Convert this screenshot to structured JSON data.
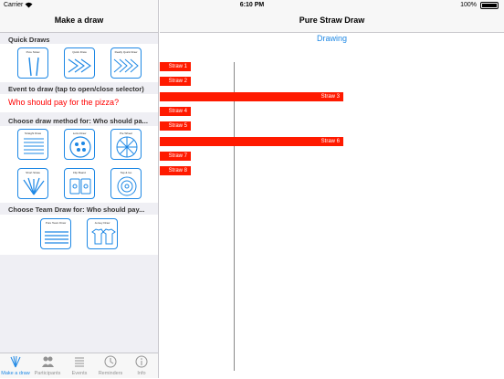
{
  "status_bar": {
    "carrier": "Carrier",
    "wifi_icon": "wifi-icon",
    "time": "6:10 PM",
    "battery": "100%"
  },
  "left": {
    "title": "Make a draw",
    "quick_draws_header": "Quick Draws",
    "quick_draws": [
      {
        "caption": "Pure Straw",
        "icon": "straws-icon"
      },
      {
        "caption": "Quick Draw",
        "icon": "arrows-icon"
      },
      {
        "caption": "Really Quick Draw",
        "icon": "arrows-icon"
      }
    ],
    "event_header": "Event to draw (tap to open/close selector)",
    "event_value": "Who should pay for the pizza?",
    "method_header": "Choose draw method for: Who should pa...",
    "methods": [
      {
        "caption": "Straight Draw",
        "icon": "lines-icon"
      },
      {
        "caption": "Lotto Draw",
        "icon": "lotto-icon"
      },
      {
        "caption": "Pie Wheel",
        "icon": "pie-wheel-icon"
      },
      {
        "caption": "Short Straw",
        "icon": "short-straw-icon"
      },
      {
        "caption": "Flip Board",
        "icon": "flip-board-icon"
      },
      {
        "caption": "Tap & Go",
        "icon": "target-icon"
      }
    ],
    "team_header": "Choose Team Draw for: Who should pay...",
    "team_draws": [
      {
        "caption": "Pure Team Draw",
        "icon": "team-list-icon"
      },
      {
        "caption": "Jersey Draw",
        "icon": "jersey-icon"
      }
    ],
    "tabs": [
      {
        "label": "Make a draw",
        "icon": "straws-icon",
        "active": true
      },
      {
        "label": "Participants",
        "icon": "people-icon",
        "active": false
      },
      {
        "label": "Events",
        "icon": "list-icon",
        "active": false
      },
      {
        "label": "Reminders",
        "icon": "clock-icon",
        "active": false
      },
      {
        "label": "Info",
        "icon": "info-icon",
        "active": false
      }
    ]
  },
  "right": {
    "title": "Pure Straw Draw",
    "status": "Drawing",
    "straws": [
      {
        "label": "Straw 1",
        "length": 0.14
      },
      {
        "label": "Straw 2",
        "length": 0.14
      },
      {
        "label": "Straw 3",
        "length": 0.83
      },
      {
        "label": "Straw 4",
        "length": 0.14
      },
      {
        "label": "Straw 5",
        "length": 0.14
      },
      {
        "label": "Straw 6",
        "length": 0.83
      },
      {
        "label": "Straw 7",
        "length": 0.14
      },
      {
        "label": "Straw 8",
        "length": 0.14
      }
    ],
    "colors": {
      "straw": "#ff1a00",
      "accent": "#1e88e5"
    }
  }
}
